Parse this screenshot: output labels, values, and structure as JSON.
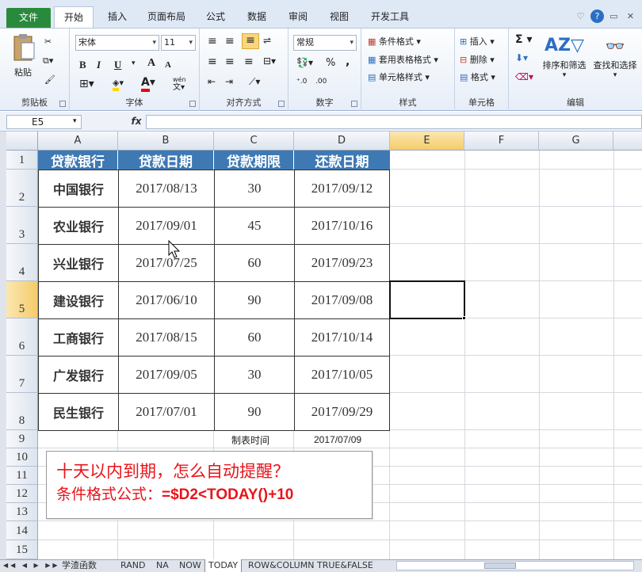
{
  "ribbon_tabs": [
    "文件",
    "开始",
    "插入",
    "页面布局",
    "公式",
    "数据",
    "审阅",
    "视图",
    "开发工具"
  ],
  "clipboard": {
    "paste": "粘贴",
    "label": "剪贴板"
  },
  "font": {
    "name": "宋体",
    "size": "11",
    "bold": "B",
    "italic": "I",
    "underline": "U",
    "grow": "A",
    "shrink": "A",
    "label": "字体",
    "wen": "wén"
  },
  "alignment": {
    "label": "对齐方式"
  },
  "number": {
    "format": "常规",
    "percent": "%",
    "comma": ",",
    "label": "数字"
  },
  "styles": {
    "conditional": "条件格式",
    "table": "套用表格格式",
    "cell": "单元格样式",
    "label": "样式"
  },
  "cells": {
    "insert": "插入",
    "delete": "删除",
    "format": "格式",
    "label": "单元格"
  },
  "editing": {
    "sum": "Σ",
    "sort": "排序和筛选",
    "find": "查找和选择",
    "label": "编辑"
  },
  "formula_bar": {
    "name_box": "E5",
    "fx": "fx",
    "value": ""
  },
  "columns": [
    "A",
    "B",
    "C",
    "D",
    "E",
    "F",
    "G"
  ],
  "rows": [
    "1",
    "2",
    "3",
    "4",
    "5",
    "6",
    "7",
    "8",
    "9",
    "10",
    "11",
    "12",
    "13",
    "14",
    "15"
  ],
  "table": {
    "headers": [
      "贷款银行",
      "贷款日期",
      "贷款期限",
      "还款日期"
    ],
    "rows": [
      [
        "中国银行",
        "2017/08/13",
        "30",
        "2017/09/12"
      ],
      [
        "农业银行",
        "2017/09/01",
        "45",
        "2017/10/16"
      ],
      [
        "兴业银行",
        "2017/07/25",
        "60",
        "2017/09/23"
      ],
      [
        "建设银行",
        "2017/06/10",
        "90",
        "2017/09/08"
      ],
      [
        "工商银行",
        "2017/08/15",
        "60",
        "2017/10/14"
      ],
      [
        "广发银行",
        "2017/09/05",
        "30",
        "2017/10/05"
      ],
      [
        "民生银行",
        "2017/07/01",
        "90",
        "2017/09/29"
      ]
    ]
  },
  "made_time": {
    "label": "制表时间",
    "value": "2017/07/09"
  },
  "note": {
    "line1": "十天以内到期，怎么自动提醒？",
    "line2_prefix": "条件格式公式：",
    "line2_formula": "=$D2<TODAY()+10"
  },
  "sheet_tabs": [
    "学渣函数",
    "RAND",
    "NA",
    "NOW",
    "TODAY",
    "ROW&COLUMN",
    "TRUE&FALSE"
  ],
  "active_sheet": "TODAY",
  "colors": {
    "header_bg": "#3f79b4",
    "note_text": "#e8141b",
    "file_tab": "#2a8a3c",
    "selected_header": "#f4d27a"
  }
}
